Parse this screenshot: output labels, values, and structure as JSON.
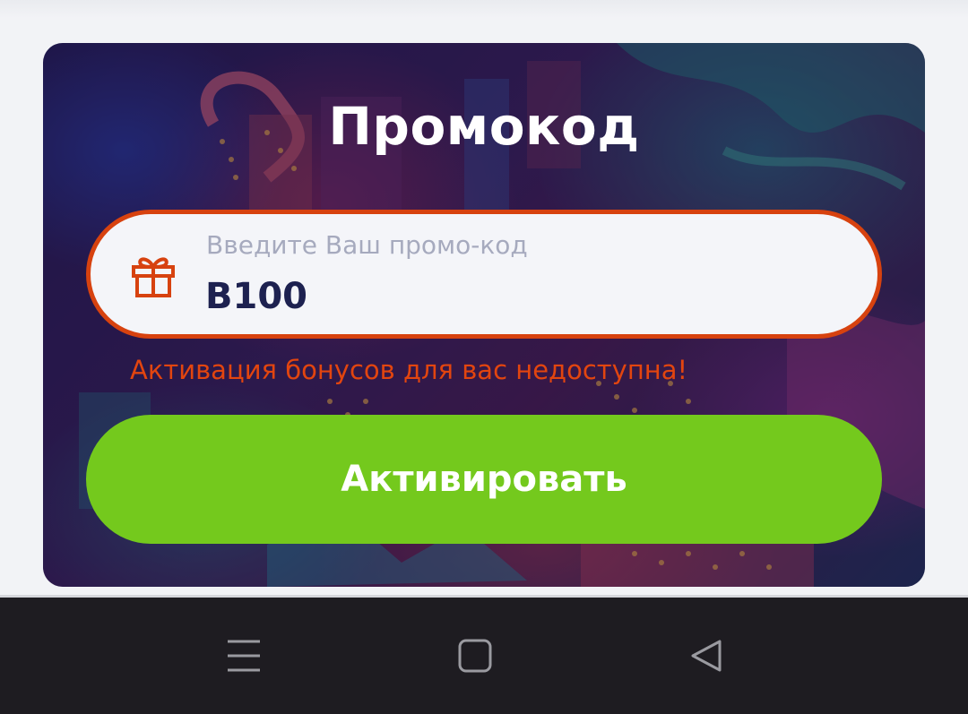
{
  "promo": {
    "title": "Промокод",
    "input_label": "Введите Ваш промо-код",
    "input_value": "B100",
    "error_message": "Активация бонусов для вас недоступна!",
    "activate_label": "Активировать"
  },
  "nav_bar": {
    "buttons": [
      {
        "name": "recent-apps",
        "icon": "menu-lines-icon"
      },
      {
        "name": "home",
        "icon": "square-icon"
      },
      {
        "name": "back",
        "icon": "triangle-back-icon"
      }
    ]
  },
  "colors": {
    "accent_orange": "#d7420f",
    "error_text": "#e2450f",
    "button_green": "#74c91d",
    "input_text": "#1d2150",
    "label_text": "#a6aabe",
    "nav_bar_bg": "#1e1c21"
  }
}
